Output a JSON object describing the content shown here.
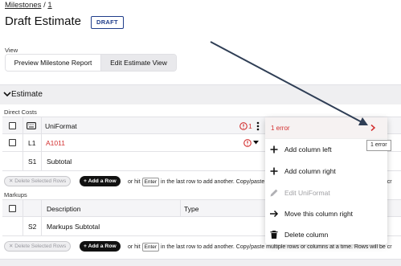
{
  "breadcrumb": {
    "link": "Milestones",
    "sep": "/",
    "current": "1"
  },
  "page": {
    "title": "Draft Estimate",
    "badge": "DRAFT"
  },
  "view": {
    "label": "View",
    "tabs": [
      {
        "label": "Preview Milestone Report",
        "selected": false
      },
      {
        "label": "Edit Estimate View",
        "selected": true
      }
    ]
  },
  "estimate": {
    "section_label": "Estimate",
    "direct_costs": {
      "group_label": "Direct Costs",
      "header": {
        "column": "UniFormat",
        "error_count": "1"
      },
      "rows": [
        {
          "level": "L1",
          "code": "A1011"
        },
        {
          "level": "S1",
          "label": "Subtotal"
        }
      ],
      "delete_label": "Delete Selected Rows",
      "add_label": "+ Add a Row",
      "hint_pre": "or hit",
      "hint_key": "Enter",
      "hint_post": "in the last row to add another. Copy/paste multiple rows or columns at a time. Rows will be cr"
    },
    "markups": {
      "group_label": "Markups",
      "columns": [
        "Description",
        "Type"
      ],
      "rows": [
        {
          "level": "S2",
          "label": "Markups Subtotal"
        }
      ],
      "delete_label": "Delete Selected Rows",
      "add_label": "+ Add a Row",
      "hint_pre": "or hit",
      "hint_key": "Enter",
      "hint_post": "in the last row to add another. Copy/paste multiple rows or columns at a time. Rows will be cr"
    }
  },
  "context_menu": {
    "error_label": "1 error",
    "items": [
      {
        "label": "Add column left",
        "icon": "plus-icon",
        "disabled": false
      },
      {
        "label": "Add column right",
        "icon": "plus-icon",
        "disabled": false
      },
      {
        "label": "Edit UniFormat",
        "icon": "pencil-icon",
        "disabled": true
      },
      {
        "label": "Move this column right",
        "icon": "arrow-right-icon",
        "disabled": false
      },
      {
        "label": "Delete column",
        "icon": "trash-icon",
        "disabled": false
      }
    ]
  },
  "tooltip": {
    "label": "1 error"
  },
  "colors": {
    "error": "#d32f2f",
    "brand": "#1f3d8a",
    "section_bg": "#efeff1"
  }
}
